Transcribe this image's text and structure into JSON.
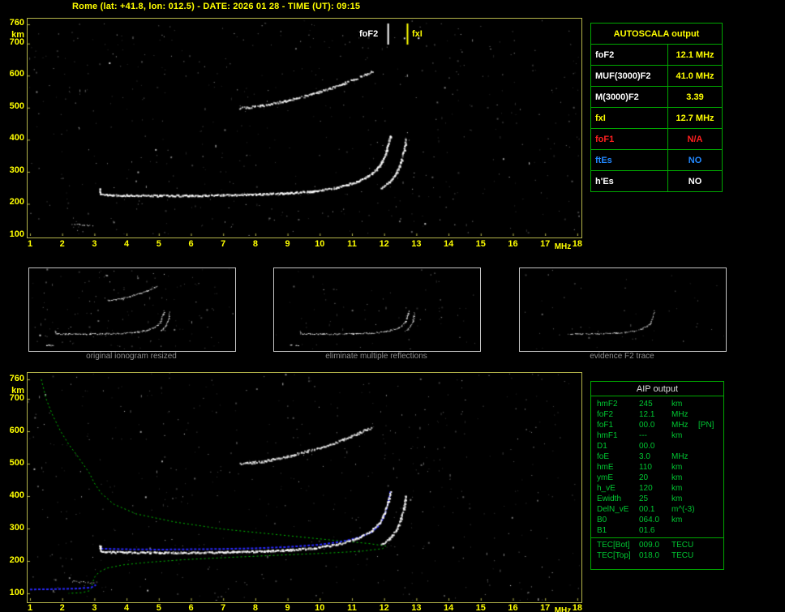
{
  "title": "Rome (lat: +41.8, lon: 012.5) - DATE: 2026 01 28 - TIME (UT): 09:15",
  "colors": {
    "accent_yellow": "#ffff00",
    "table_green": "#00a800",
    "aip_text_green": "#00c832",
    "alert_red": "#ff2020",
    "info_blue": "#2288ff",
    "profile_green": "#00c000",
    "model_blue": "#2828ff"
  },
  "markers": {
    "fof2_label": "foF2",
    "fxi_label": "fxI",
    "fof2_freq": 12.1,
    "fxi_freq": 12.7
  },
  "axes": {
    "x_ticks": [
      "1",
      "2",
      "3",
      "4",
      "5",
      "6",
      "7",
      "8",
      "9",
      "10",
      "11",
      "12",
      "13",
      "14",
      "15",
      "16",
      "17",
      "18"
    ],
    "x_unit": "MHz",
    "y_ticks": [
      "760",
      "700",
      "600",
      "500",
      "400",
      "300",
      "200",
      "100"
    ],
    "y_unit": "km"
  },
  "autoscala_table": {
    "header": "AUTOSCALA output",
    "rows": [
      {
        "label": "foF2",
        "value": "12.1 MHz",
        "label_color": "#ffffff",
        "value_color": "#ffff00"
      },
      {
        "label": "MUF(3000)F2",
        "value": "41.0 MHz",
        "label_color": "#ffffff",
        "value_color": "#ffff00"
      },
      {
        "label": "M(3000)F2",
        "value": "3.39",
        "label_color": "#ffffff",
        "value_color": "#ffff00"
      },
      {
        "label": "fxI",
        "value": "12.7 MHz",
        "label_color": "#ffff00",
        "value_color": "#ffff00"
      },
      {
        "label": "foF1",
        "value": "N/A",
        "label_color": "#ff2020",
        "value_color": "#ff2020"
      },
      {
        "label": "ftEs",
        "value": "NO",
        "label_color": "#2288ff",
        "value_color": "#2288ff"
      },
      {
        "label": "h'Es",
        "value": "NO",
        "label_color": "#ffffff",
        "value_color": "#ffffff"
      }
    ]
  },
  "thumbnails": [
    {
      "caption": "original ionogram resized"
    },
    {
      "caption": "eliminate multiple reflections"
    },
    {
      "caption": "evidence F2 trace"
    }
  ],
  "aip_table": {
    "header": "AIP output",
    "rows": [
      {
        "name": "hmF2",
        "value": "245",
        "unit": "km",
        "extra": ""
      },
      {
        "name": "foF2",
        "value": "12.1",
        "unit": "MHz",
        "extra": ""
      },
      {
        "name": "foF1",
        "value": "00.0",
        "unit": "MHz",
        "extra": "[PN]"
      },
      {
        "name": "hmF1",
        "value": "---",
        "unit": "km",
        "extra": ""
      },
      {
        "name": "D1",
        "value": "00.0",
        "unit": "",
        "extra": ""
      },
      {
        "name": "foE",
        "value": "3.0",
        "unit": "MHz",
        "extra": ""
      },
      {
        "name": "hmE",
        "value": "110",
        "unit": "km",
        "extra": ""
      },
      {
        "name": "ymE",
        "value": "20",
        "unit": "km",
        "extra": ""
      },
      {
        "name": "h_vE",
        "value": "120",
        "unit": "km",
        "extra": ""
      },
      {
        "name": "Ewidth",
        "value": "25",
        "unit": "km",
        "extra": ""
      },
      {
        "name": "DelN_vE",
        "value": "00.1",
        "unit": "m^(-3)",
        "extra": ""
      },
      {
        "name": "B0",
        "value": "064.0",
        "unit": "km",
        "extra": ""
      },
      {
        "name": "B1",
        "value": "01.6",
        "unit": "",
        "extra": ""
      }
    ],
    "tec_rows": [
      {
        "name": "TEC[Bot]",
        "value": "009.0",
        "unit": "TECU"
      },
      {
        "name": "TEC[Top]",
        "value": "018.0",
        "unit": "TECU"
      }
    ]
  },
  "chart_data": {
    "type": "scatter",
    "title": "ionogram virtual height vs frequency",
    "xlabel": "MHz",
    "ylabel": "km",
    "x_range": [
      1,
      18
    ],
    "y_range": [
      100,
      760
    ],
    "traces": {
      "e_region_echo": [
        [
          2.3,
          138
        ],
        [
          2.55,
          136
        ],
        [
          2.8,
          134
        ],
        [
          2.95,
          133
        ]
      ],
      "f_trace_ordinary": [
        [
          3.15,
          250
        ],
        [
          3.18,
          233
        ],
        [
          3.35,
          229
        ],
        [
          4,
          228
        ],
        [
          5,
          227
        ],
        [
          6,
          227
        ],
        [
          7,
          229
        ],
        [
          8,
          231
        ],
        [
          9,
          235
        ],
        [
          9.8,
          241
        ],
        [
          10.5,
          252
        ],
        [
          11,
          266
        ],
        [
          11.3,
          278
        ],
        [
          11.6,
          295
        ],
        [
          11.85,
          320
        ],
        [
          12.0,
          350
        ],
        [
          12.1,
          385
        ],
        [
          12.18,
          415
        ]
      ],
      "f_trace_extraordinary": [
        [
          11.9,
          252
        ],
        [
          12.15,
          270
        ],
        [
          12.35,
          295
        ],
        [
          12.5,
          330
        ],
        [
          12.6,
          370
        ],
        [
          12.65,
          403
        ]
      ],
      "second_hop": [
        [
          7.5,
          500
        ],
        [
          8.2,
          508
        ],
        [
          8.9,
          522
        ],
        [
          9.6,
          540
        ],
        [
          10.2,
          558
        ],
        [
          10.7,
          575
        ],
        [
          11.1,
          592
        ],
        [
          11.4,
          605
        ],
        [
          11.6,
          613
        ]
      ]
    },
    "profile_green": [
      [
        1.35,
        760
      ],
      [
        1.5,
        700
      ],
      [
        1.7,
        650
      ],
      [
        1.95,
        600
      ],
      [
        2.2,
        560
      ],
      [
        2.5,
        520
      ],
      [
        2.85,
        470
      ],
      [
        3.0,
        440
      ],
      [
        3.2,
        410
      ],
      [
        3.6,
        375
      ],
      [
        4.3,
        345
      ],
      [
        5.5,
        320
      ],
      [
        7.0,
        298
      ],
      [
        8.8,
        280
      ],
      [
        10.4,
        264
      ],
      [
        11.5,
        254
      ],
      [
        12.05,
        246
      ],
      [
        11.95,
        238
      ],
      [
        11.3,
        230
      ],
      [
        10.2,
        224
      ],
      [
        8.8,
        218
      ],
      [
        7.2,
        211
      ],
      [
        5.8,
        204
      ],
      [
        4.7,
        196
      ],
      [
        3.9,
        188
      ],
      [
        3.4,
        178
      ],
      [
        3.15,
        166
      ],
      [
        3.02,
        152
      ],
      [
        2.97,
        140
      ],
      [
        2.93,
        128
      ],
      [
        2.9,
        116
      ],
      [
        2.85,
        108
      ],
      [
        2.6,
        102
      ],
      [
        2.2,
        100
      ]
    ],
    "model_trace_blue": [
      [
        3.2,
        238
      ],
      [
        4,
        236
      ],
      [
        5,
        235
      ],
      [
        6,
        236
      ],
      [
        7,
        237
      ],
      [
        8,
        239
      ],
      [
        9,
        243
      ],
      [
        10,
        250
      ],
      [
        10.7,
        260
      ],
      [
        11.2,
        272
      ],
      [
        11.6,
        288
      ],
      [
        11.85,
        310
      ],
      [
        12.0,
        338
      ],
      [
        12.1,
        368
      ],
      [
        12.17,
        400
      ],
      [
        12.2,
        418
      ]
    ],
    "model_e_blue": [
      [
        1.0,
        112
      ],
      [
        1.8,
        113
      ],
      [
        2.5,
        115
      ],
      [
        2.9,
        118
      ],
      [
        3.05,
        126
      ]
    ]
  }
}
